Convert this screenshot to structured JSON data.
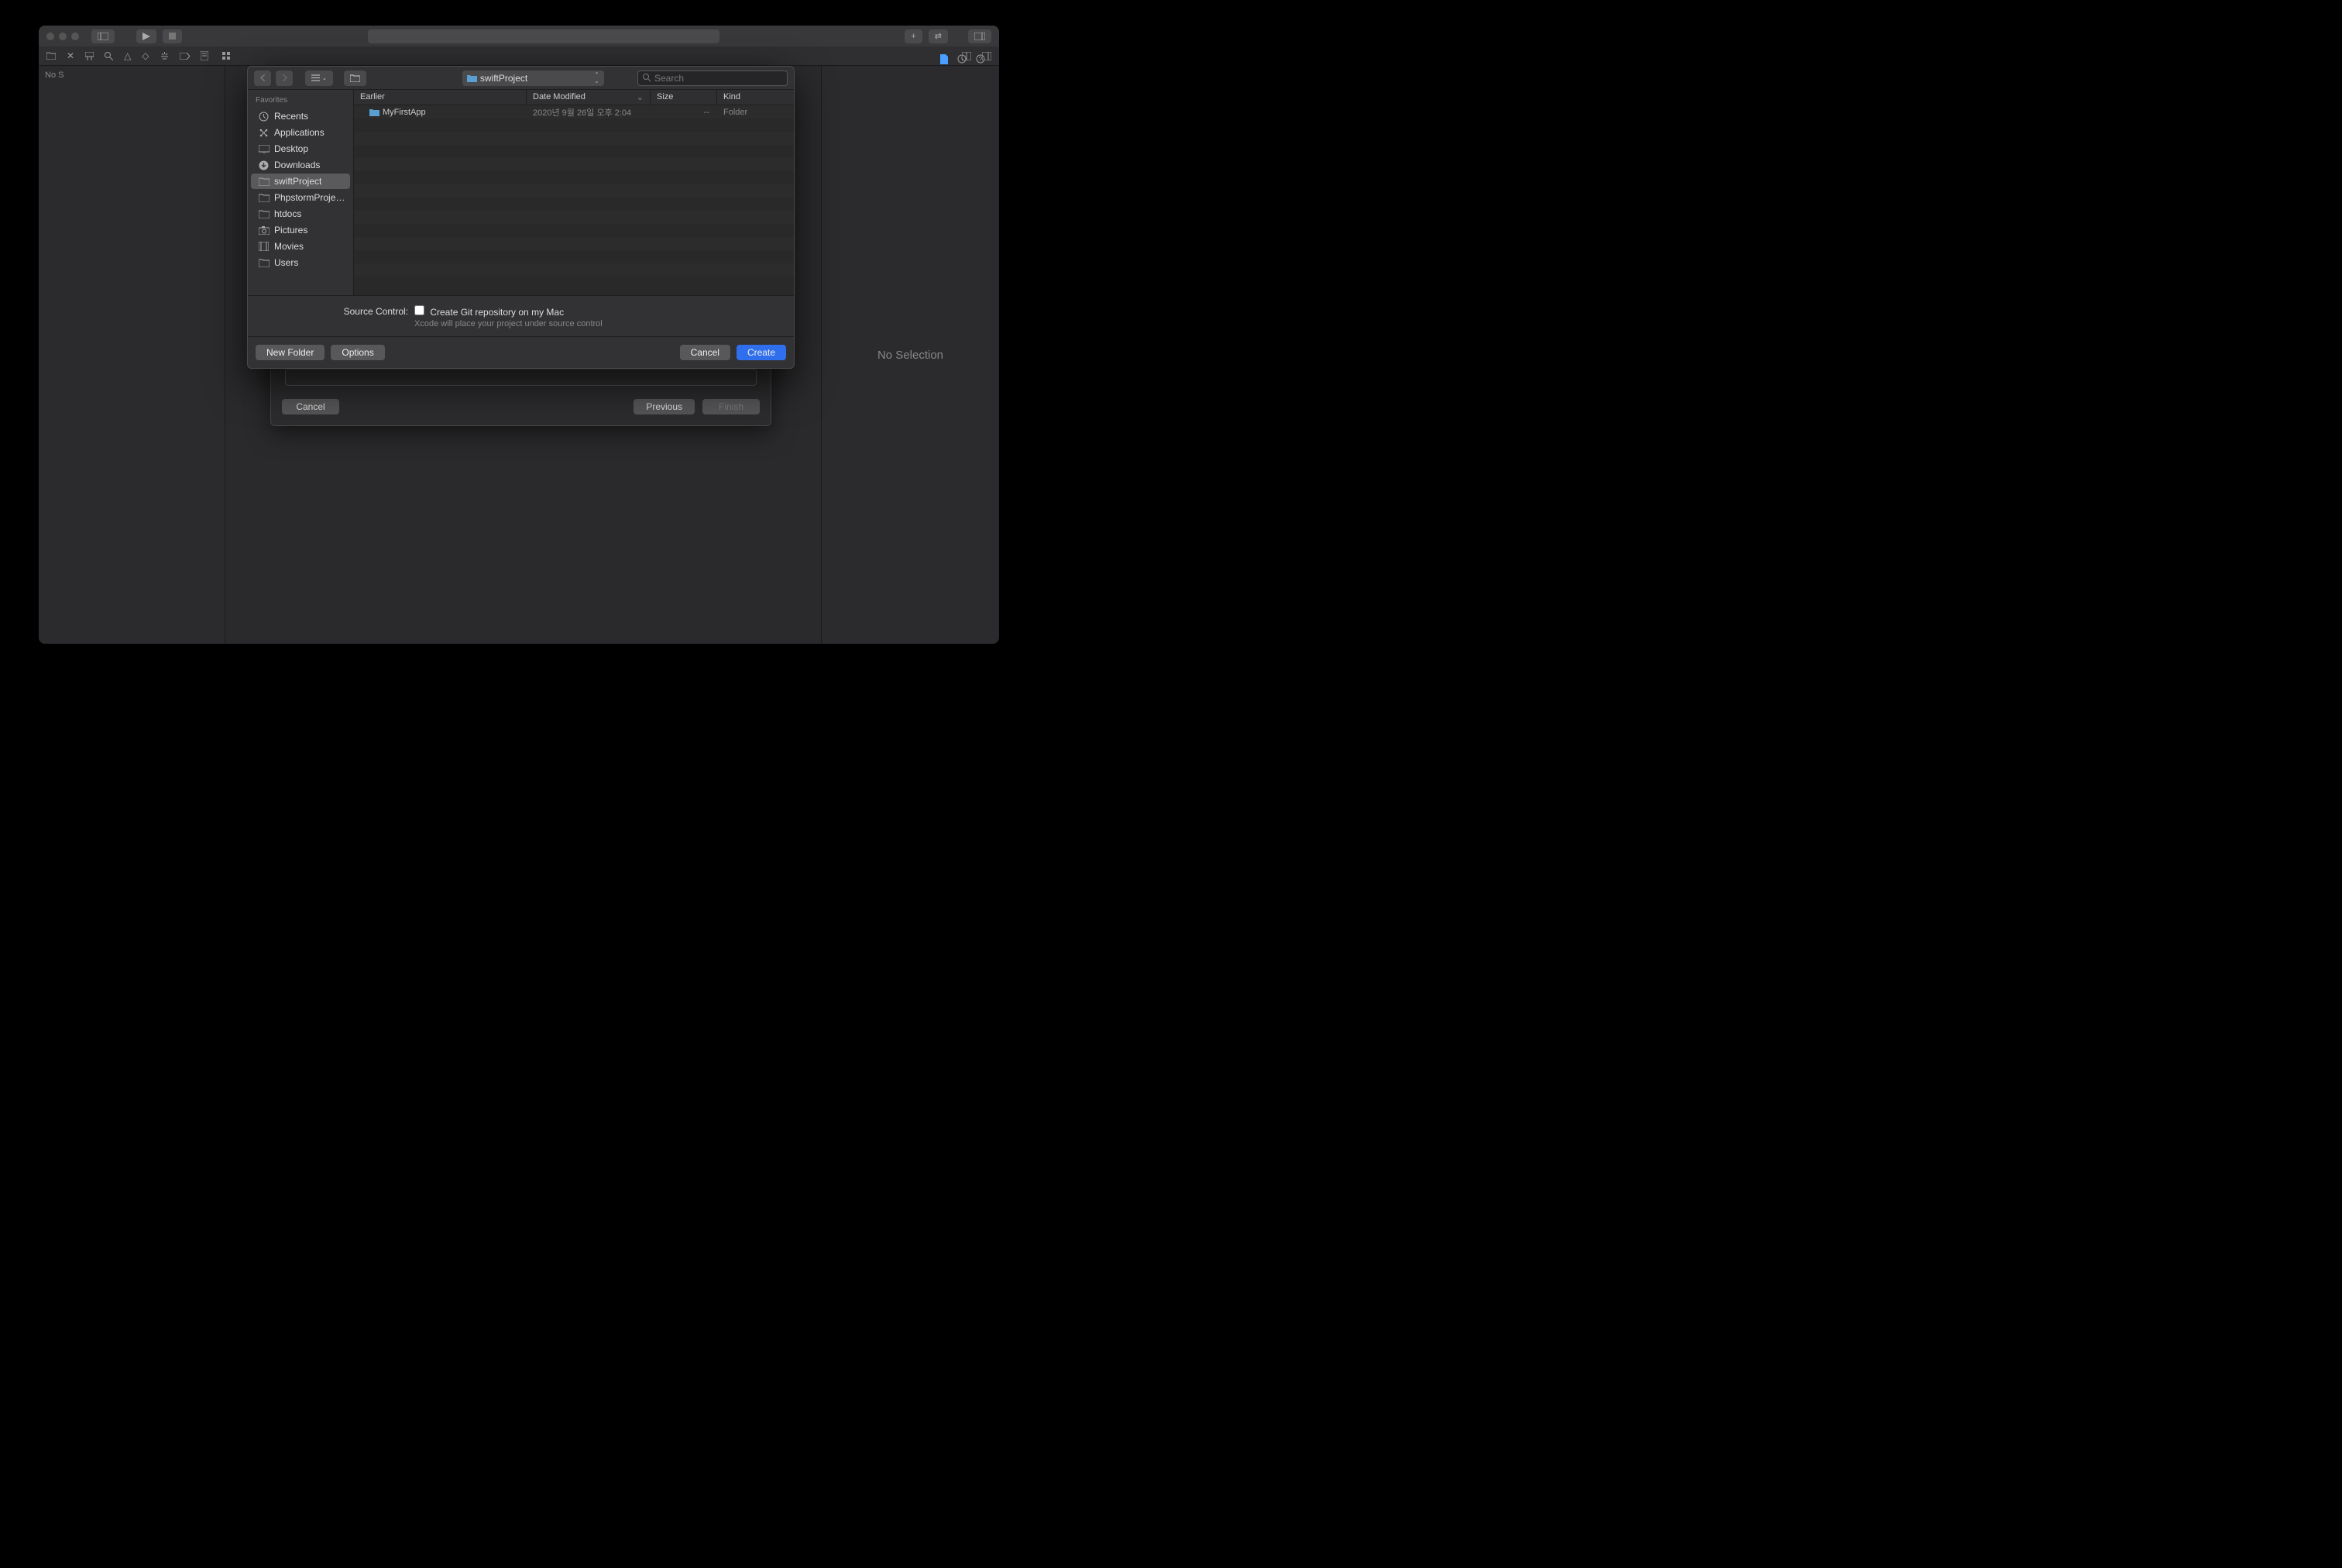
{
  "leftpanel": {
    "status": "No S"
  },
  "rightpanel": {
    "text": "No Selection"
  },
  "wizard": {
    "cancel": "Cancel",
    "previous": "Previous",
    "finish": "Finish"
  },
  "saveDialog": {
    "path": "swiftProject",
    "search_placeholder": "Search",
    "sidebar": {
      "header": "Favorites",
      "items": [
        {
          "icon": "clock",
          "label": "Recents"
        },
        {
          "icon": "apps",
          "label": "Applications"
        },
        {
          "icon": "desktop",
          "label": "Desktop"
        },
        {
          "icon": "download",
          "label": "Downloads"
        },
        {
          "icon": "folder",
          "label": "swiftProject",
          "selected": true
        },
        {
          "icon": "folder",
          "label": "PhpstormProje…"
        },
        {
          "icon": "folder",
          "label": "htdocs"
        },
        {
          "icon": "camera",
          "label": "Pictures"
        },
        {
          "icon": "film",
          "label": "Movies"
        },
        {
          "icon": "folder",
          "label": "Users"
        }
      ]
    },
    "columns": {
      "name_header": "Earlier",
      "date": "Date Modified",
      "size": "Size",
      "kind": "Kind",
      "sort_indicator": "⌄"
    },
    "rows": [
      {
        "name": "MyFirstApp",
        "date": "2020년 9월 26일 오후 2:04",
        "size": "--",
        "kind": "Folder"
      }
    ],
    "sourceControl": {
      "label": "Source Control:",
      "checkbox": "Create Git repository on my Mac",
      "hint": "Xcode will place your project under source control"
    },
    "buttons": {
      "newFolder": "New Folder",
      "options": "Options",
      "cancel": "Cancel",
      "create": "Create"
    }
  }
}
